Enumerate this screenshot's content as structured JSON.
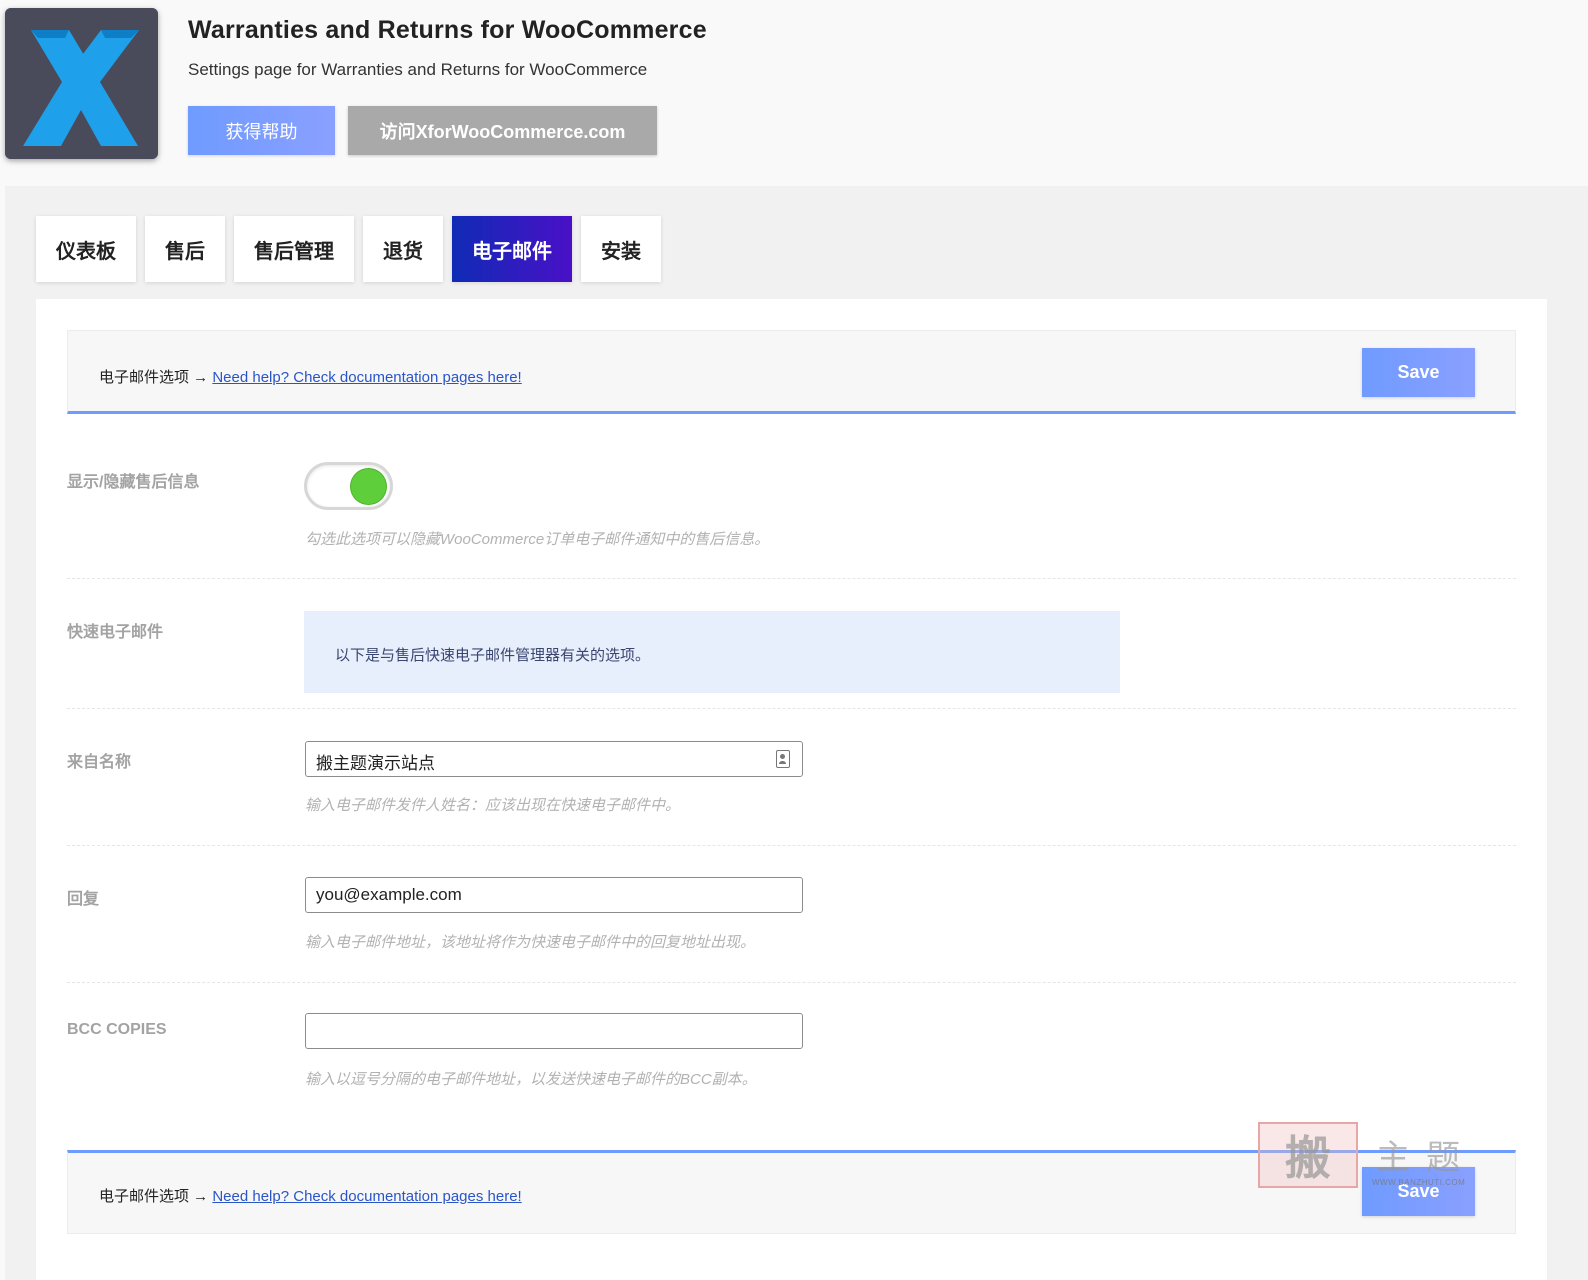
{
  "header": {
    "title": "Warranties and Returns for WooCommerce",
    "subtitle": "Settings page for Warranties and Returns for WooCommerce",
    "help_button": "获得帮助",
    "visit_button": "访问XforWooCommerce.com",
    "logo_icon": "x-logo-icon"
  },
  "tabs": [
    {
      "label": "仪表板"
    },
    {
      "label": "售后"
    },
    {
      "label": "售后管理"
    },
    {
      "label": "退货"
    },
    {
      "label": "电子邮件",
      "active": true
    },
    {
      "label": "安装"
    }
  ],
  "top_bar": {
    "section": "电子邮件选项 →",
    "help_link": "Need help? Check documentation pages here!",
    "save": "Save"
  },
  "bottom_bar": {
    "section": "电子邮件选项 →",
    "help_link": "Need help? Check documentation pages here!",
    "save": "Save"
  },
  "settings": {
    "show_hide": {
      "label": "显示/隐藏售后信息",
      "enabled": true,
      "description": "勾选此选项可以隐藏WooCommerce订单电子邮件通知中的售后信息。"
    },
    "quick_email": {
      "label": "快速电子邮件",
      "notice": "以下是与售后快速电子邮件管理器有关的选项。"
    },
    "from_name": {
      "label": "来自名称",
      "value": "搬主题演示站点",
      "description": "输入电子邮件发件人姓名：应该出现在快速电子邮件中。"
    },
    "reply_to": {
      "label": "回复",
      "value": "you@example.com",
      "description": "输入电子邮件地址，该地址将作为快速电子邮件中的回复地址出现。"
    },
    "bcc": {
      "label": "BCC COPIES",
      "value": "",
      "description": "输入以逗号分隔的电子邮件地址，以发送快速电子邮件的BCC副本。"
    }
  },
  "watermark": {
    "char": "搬",
    "chars": "主题",
    "url": "WWW.BANZHUTI.COM"
  },
  "colors": {
    "accent": "#6f9bff",
    "active_tab_start": "#0f2bb5",
    "active_tab_end": "#4a10c7",
    "toggle_on": "#5ecf3a",
    "logo_bg": "#494b5a",
    "logo_x": "#1fa0ea"
  }
}
